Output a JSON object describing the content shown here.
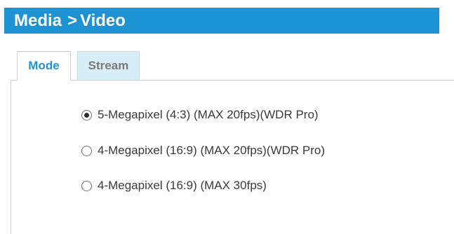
{
  "header": {
    "section": "Media",
    "separator": ">",
    "page": "Video"
  },
  "tabs": [
    {
      "label": "Mode",
      "active": true
    },
    {
      "label": "Stream",
      "active": false
    }
  ],
  "mode_options": [
    {
      "label": "5-Megapixel (4:3) (MAX 20fps)(WDR Pro)",
      "selected": true
    },
    {
      "label": "4-Megapixel (16:9) (MAX 20fps)(WDR Pro)",
      "selected": false
    },
    {
      "label": "4-Megapixel (16:9) (MAX 30fps)",
      "selected": false
    }
  ],
  "colors": {
    "header_background": "#1d93d3",
    "header_text": "#ffffff",
    "active_tab_text": "#1d93d3",
    "inactive_tab_background": "#d6eef8",
    "inactive_tab_text": "#7a7a7a"
  }
}
